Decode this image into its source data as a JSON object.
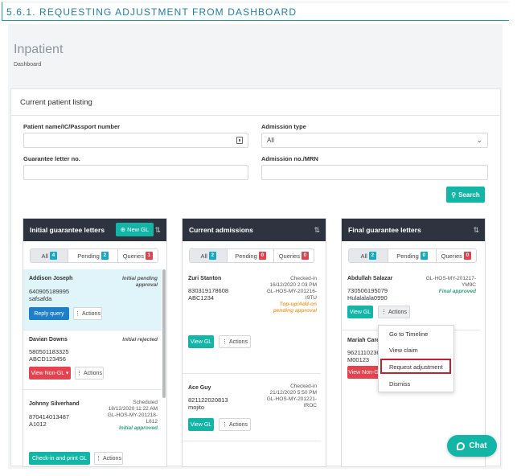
{
  "doc_heading": "5.6.1.  REQUESTING ADJUSTMENT FROM DASHBOARD",
  "page": {
    "title": "Inpatient",
    "subtitle": "Dashboard"
  },
  "listing": {
    "title": "Current patient listing",
    "patient_label": "Patient name/IC/Passport number",
    "patient_value": "",
    "admission_type_label": "Admission type",
    "admission_type_value": "All",
    "gl_label": "Guarantee letter no.",
    "gl_value": "",
    "admission_no_label": "Admission no./MRN",
    "admission_no_value": "",
    "search_label": "Search"
  },
  "initial": {
    "title": "Initial guarantee letters",
    "new_gl": "New GL",
    "tabs": [
      {
        "label": "All",
        "count": "4"
      },
      {
        "label": "Pending",
        "count": "2"
      },
      {
        "label": "Queries",
        "count": "1"
      }
    ],
    "items": [
      {
        "name": "Addison Joseph",
        "id": "640905189995",
        "ref": "safsafda",
        "status1": "Initial pending",
        "status2": "approval",
        "btn1": "Reply query",
        "btn2": "Actions"
      },
      {
        "name": "Davian Downs",
        "id": "580501183325",
        "ref": "ABCD123456",
        "status": "Initial rejected",
        "btn1": "View Non-GL ▾",
        "btn2": "Actions"
      },
      {
        "name": "Johnny Silverhand",
        "id": "870414013487",
        "ref": "A1012",
        "r1": "Scheduled",
        "r2": "18/12/2020 11:22 AM",
        "r3": "GL-HOS-MY-201218-",
        "r4": "L612",
        "status": "Initial approved",
        "btn1": "Check-in and print GL",
        "btn2": "Actions"
      }
    ]
  },
  "current": {
    "title": "Current admissions",
    "tabs": [
      {
        "label": "All",
        "count": "2"
      },
      {
        "label": "Pending",
        "count": "0"
      },
      {
        "label": "Queries",
        "count": "0"
      }
    ],
    "items": [
      {
        "name": "Zuri Stanton",
        "id": "830319178608",
        "ref": "ABC1234",
        "r1": "Checked-in",
        "r2": "16/12/2020 2:03 PM",
        "r3": "GL-HOS-MY-201216-",
        "r4": "I9TU",
        "status1": "Top-up/Add-on",
        "status2": "pending approval",
        "btn1": "View GL",
        "btn2": "Actions"
      },
      {
        "name": "Ace Guy",
        "id": "821122020813",
        "ref": "mojito",
        "r1": "Checked-in",
        "r2": "21/12/2020 5:50 PM",
        "r3": "GL-HOS-MY-201221-",
        "r4": "IROC",
        "btn1": "View GL",
        "btn2": "Actions"
      }
    ]
  },
  "final": {
    "title": "Final guarantee letters",
    "tabs": [
      {
        "label": "All",
        "count": "2"
      },
      {
        "label": "Pending",
        "count": "0"
      },
      {
        "label": "Queries",
        "count": "0"
      }
    ],
    "items": [
      {
        "name": "Abdullah Salazar",
        "id": "730506195079",
        "ref": "Hulalalala0990",
        "r1": "GL-HOS-MY-201217-",
        "r2": "YM9C",
        "status": "Final approved",
        "btn1": "View GL",
        "btn2": "Actions"
      },
      {
        "name": "Mariah Care",
        "id": "9621110236",
        "ref": "M00123",
        "btn1": "View Non-G"
      }
    ]
  },
  "context_menu": [
    "Go to Timeline",
    "View claim",
    "Request adjustment",
    "Dismiss"
  ],
  "chat_label": "Chat",
  "colors": {
    "accent": "#13b6a6",
    "header": "#2d3440",
    "highlight": "#c0222e",
    "blue": "#1f7ec8",
    "red": "#e4424f"
  }
}
